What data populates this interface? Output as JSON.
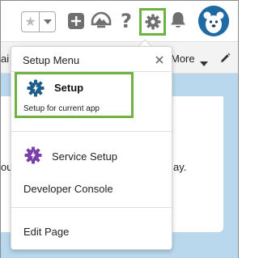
{
  "header": {
    "favorites_star": "★",
    "help_glyph": "?"
  },
  "background": {
    "tab_edge_text": "ai",
    "more_label": "More",
    "body_text_left": "ou",
    "body_text_right": "ay."
  },
  "menu": {
    "title": "Setup Menu",
    "items": [
      {
        "label": "Setup",
        "subtitle": "Setup for current app",
        "icon": "setup-gear-icon",
        "icon_color": "#1f5e8a"
      },
      {
        "label": "Service Setup",
        "icon": "service-setup-gear-icon",
        "icon_color": "#7a3fa8"
      },
      {
        "label": "Developer Console"
      },
      {
        "label": "Edit Page"
      }
    ]
  },
  "colors": {
    "highlight": "#6fb143",
    "avatar": "#1d6aa5",
    "background_app": "#b9d8ee"
  }
}
